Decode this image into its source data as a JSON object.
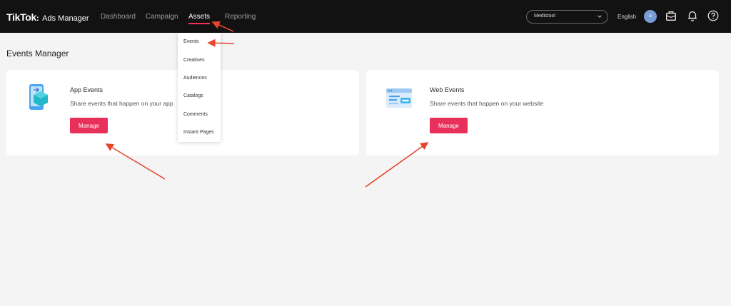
{
  "header": {
    "logo_brand": "TikTok",
    "logo_dot": ":",
    "logo_sub": "Ads Manager",
    "nav": [
      "Dashboard",
      "Campaign",
      "Assets",
      "Reporting"
    ],
    "active_nav": "Assets",
    "account_name": "Medistool",
    "language": "English",
    "avatar_initial": "u",
    "icons": [
      "briefcase-icon",
      "bell-icon",
      "help-icon"
    ]
  },
  "assets_menu": {
    "items": [
      "Events",
      "Creatives",
      "Audiences",
      "Catalogs",
      "Comments",
      "Instant Pages"
    ]
  },
  "page": {
    "title": "Events Manager"
  },
  "cards": [
    {
      "title": "App Events",
      "description": "Share events that happen on your app",
      "button_label": "Manage",
      "icon": "app-events-icon"
    },
    {
      "title": "Web Events",
      "description": "Share events that happen on your website",
      "button_label": "Manage",
      "icon": "web-events-icon"
    }
  ],
  "colors": {
    "topbar": "#121212",
    "accent": "#fe2c55",
    "button": "#e8305b",
    "annotation_arrow": "#e8452c",
    "page_bg": "#f4f4f5"
  }
}
